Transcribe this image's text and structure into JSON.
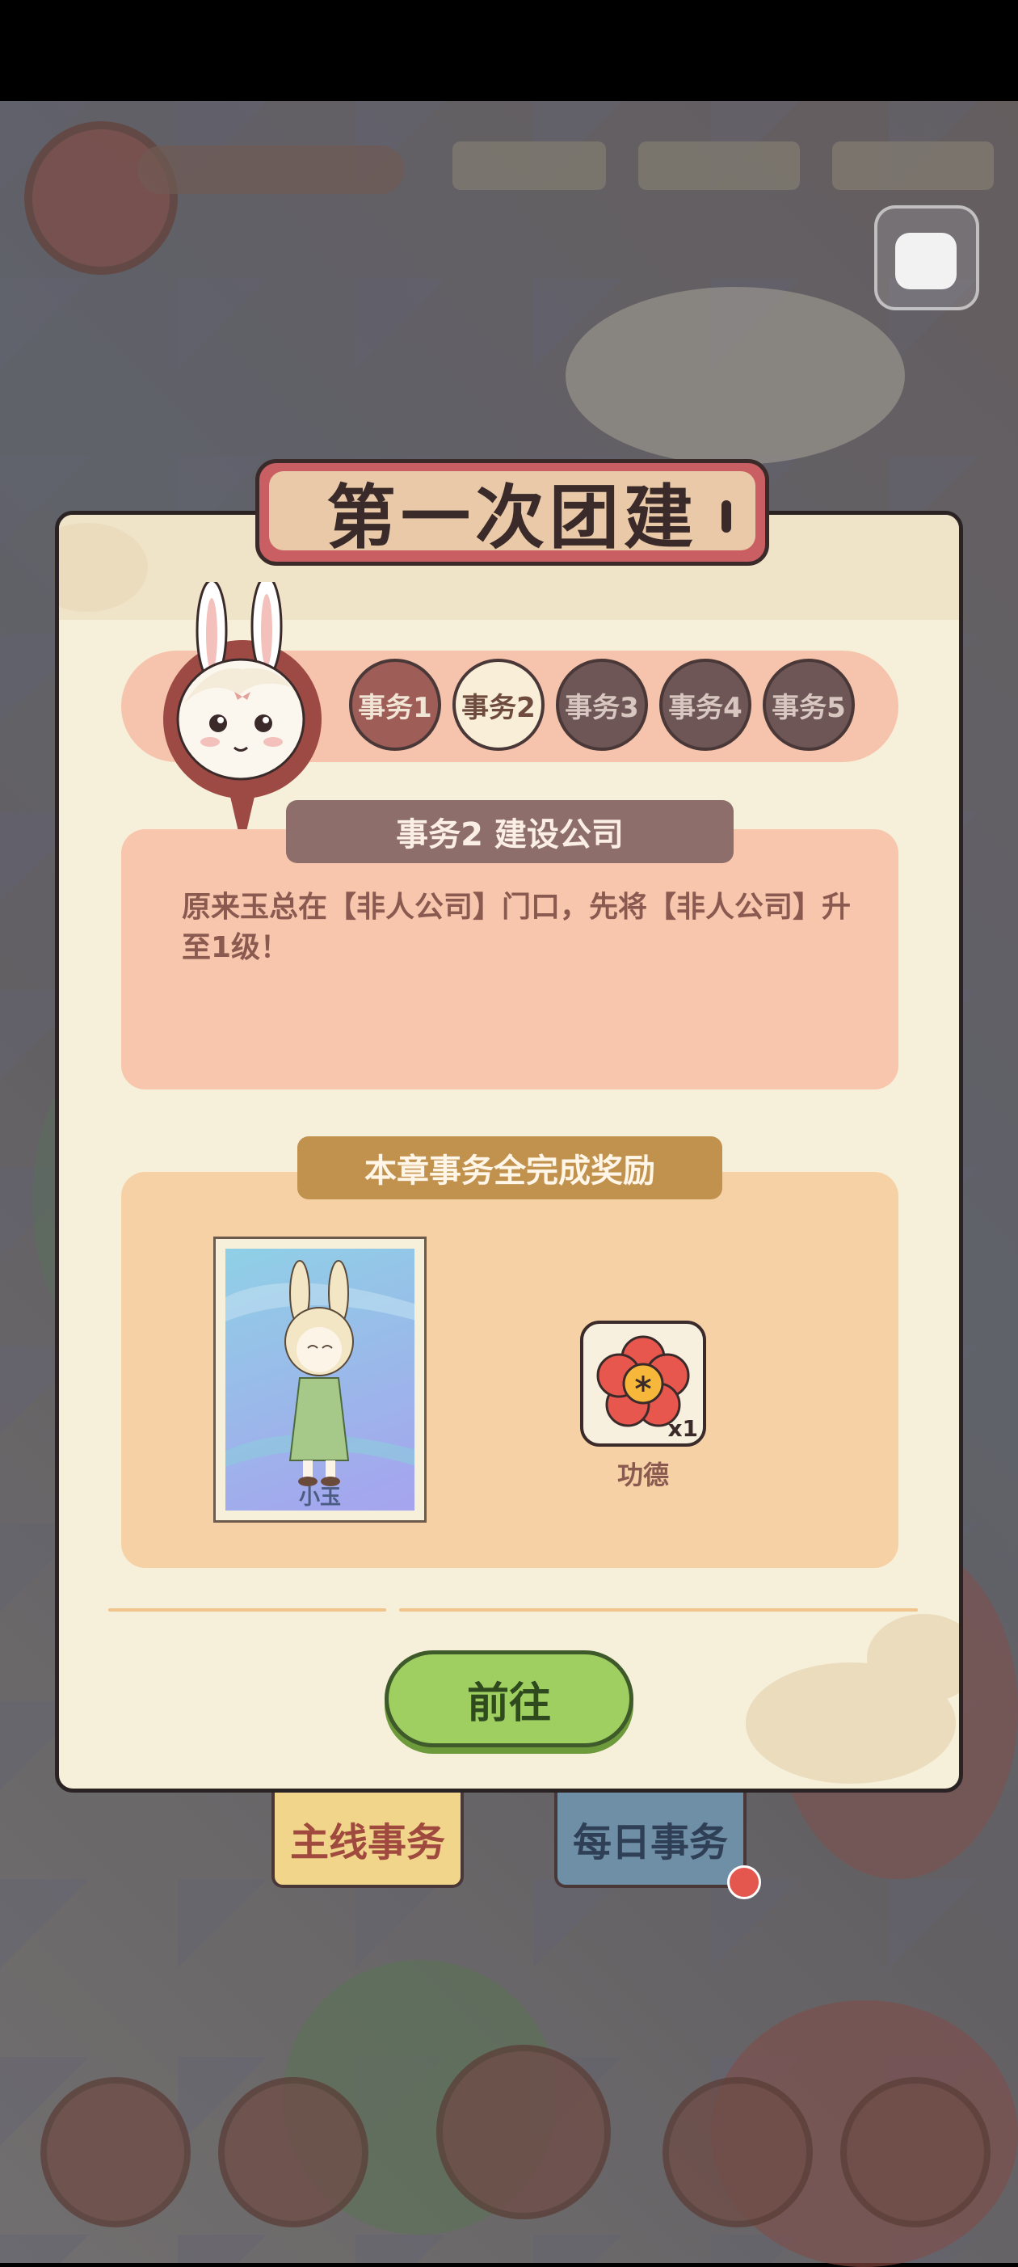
{
  "dialog": {
    "title": "第一次团建",
    "tasks": [
      {
        "label": "事务1",
        "state": "done"
      },
      {
        "label": "事务2",
        "state": "active"
      },
      {
        "label": "事务3",
        "state": "locked"
      },
      {
        "label": "事务4",
        "state": "locked"
      },
      {
        "label": "事务5",
        "state": "locked"
      }
    ],
    "current_task": {
      "title": "事务2  建设公司",
      "description": "原来玉总在【非人公司】门口，先将【非人公司】升至1级！"
    },
    "reward": {
      "title": "本章事务全完成奖励",
      "card": {
        "name": "小玉"
      },
      "item": {
        "name": "功德",
        "count": "x1"
      }
    },
    "go_button": "前往"
  },
  "tabs": {
    "main": "主线事务",
    "daily": "每日事务"
  },
  "colors": {
    "panel_bg": "#f6efd9",
    "task_strip": "#f6c4ad",
    "go_button": "#9fcf60",
    "notification_dot": "#e4574f"
  }
}
